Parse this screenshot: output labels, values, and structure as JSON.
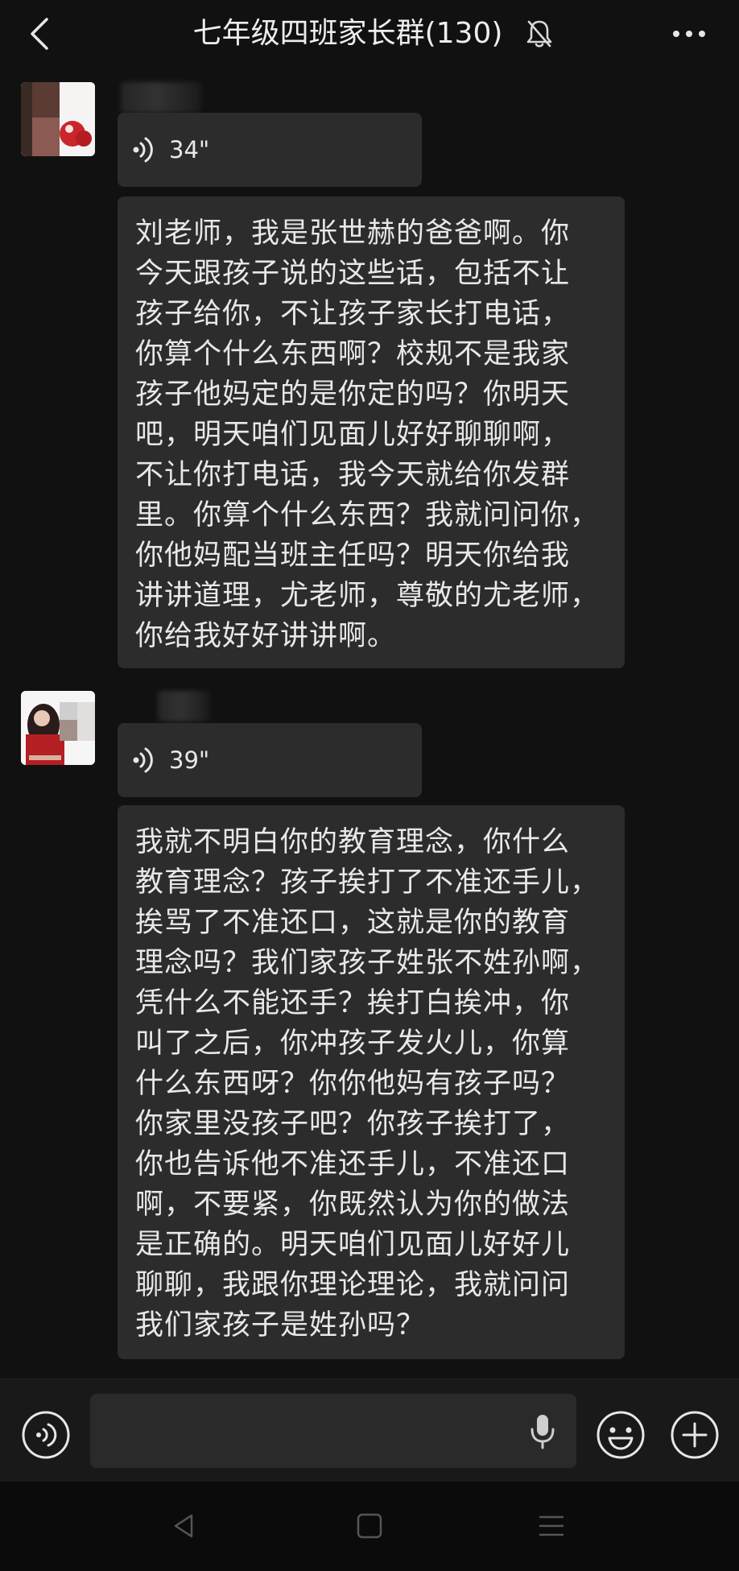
{
  "header": {
    "title": "七年级四班家长群(130)",
    "back_icon": "chevron-left-icon",
    "mute_icon": "bell-muted-icon",
    "more_icon": "ellipsis-icon"
  },
  "messages": [
    {
      "voice_duration": "34\"",
      "text_lines": [
        "刘老师，我是张世赫的爸爸啊。你",
        "今天跟孩子说的这些话，包括不让",
        "孩子给你，不让孩子家长打电话，",
        "你算个什么东西啊？校规不是我家",
        "孩子他妈定的是你定的吗？你明天",
        "吧，明天咱们见面儿好好聊聊啊，",
        "不让你打电话，我今天就给你发群",
        "里。你算个什么东西？我就问问你，",
        "你他妈配当班主任吗？明天你给我",
        "讲讲道理，尤老师，尊敬的尤老师，",
        "你给我好好讲讲啊。"
      ]
    },
    {
      "voice_duration": "39\"",
      "text_lines": [
        "我就不明白你的教育理念，你什么",
        "教育理念？孩子挨打了不准还手儿，",
        "挨骂了不准还口，这就是你的教育",
        "理念吗？我们家孩子姓张不姓孙啊，",
        "凭什么不能还手？挨打白挨冲，你",
        "叫了之后，你冲孩子发火儿，你算",
        "什么东西呀？你你他妈有孩子吗？",
        "你家里没孩子吧？你孩子挨打了，",
        "你也告诉他不准还手儿，不准还口",
        "啊，不要紧，你既然认为你的做法",
        "是正确的。明天咱们见面儿好好儿",
        "聊聊，我跟你理论理论，我就问问",
        "我们家孩子是姓孙吗？"
      ]
    }
  ],
  "input_bar": {
    "value": "",
    "voice_toggle_icon": "voice-wave-icon",
    "mic_icon": "microphone-icon",
    "emoji_icon": "emoji-icon",
    "plus_icon": "plus-circle-icon"
  },
  "nav_bar": {
    "back_icon": "nav-back-icon",
    "home_icon": "nav-home-icon",
    "menu_icon": "nav-menu-icon"
  },
  "colors": {
    "background": "#111111",
    "bubble": "#2c2c2c",
    "text": "#e8e8e8",
    "input_bar": "#191919"
  }
}
